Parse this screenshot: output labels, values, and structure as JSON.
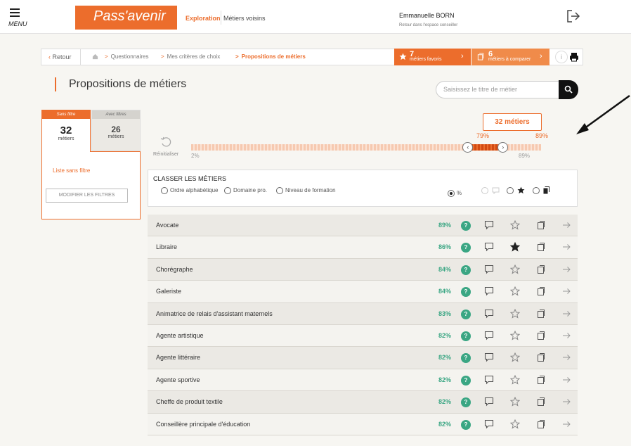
{
  "header": {
    "menu_label": "MENU",
    "logo": "Pass'avenir",
    "nav": [
      "Exploration",
      "Métiers voisins"
    ],
    "user_name": "Emmanuelle BORN",
    "user_sub": "Retour dans l'espace conseiller"
  },
  "breadcrumb": {
    "back": "Retour",
    "items": [
      "Questionnaires",
      "Mes critères de choix",
      "Propositions de métiers"
    ],
    "favorites": {
      "count": "7",
      "label": "métiers favoris"
    },
    "compare": {
      "count": "6",
      "label": "métiers à comparer"
    }
  },
  "page": {
    "title": "Propositions de métiers",
    "search_placeholder": "Saisissez le titre de métier"
  },
  "filters": {
    "tab_no_filter": {
      "label": "Sans filtre",
      "count": "32",
      "unit": "métiers"
    },
    "tab_with_filter": {
      "label": "Avec filtres",
      "count": "26",
      "unit": "métiers"
    },
    "list_label": "Liste sans filtre",
    "modify_button": "MODIFIER LES FILTRES"
  },
  "slider": {
    "count_label": "32 métiers",
    "reset_label": "Réinitialiser",
    "min_label": "2%",
    "range_low_label": "79%",
    "range_high_label": "89%",
    "below_label": "89%",
    "range_low": 0.79,
    "range_high": 0.89
  },
  "sort": {
    "title": "CLASSER LES MÉTIERS",
    "options": [
      "Ordre alphabétique",
      "Domaine pro.",
      "Niveau de formation"
    ],
    "percent_option": "%"
  },
  "jobs": [
    {
      "name": "Avocate",
      "pct": "89%",
      "favorite": false
    },
    {
      "name": "Libraire",
      "pct": "86%",
      "favorite": true
    },
    {
      "name": "Chorégraphe",
      "pct": "84%",
      "favorite": false
    },
    {
      "name": "Galeriste",
      "pct": "84%",
      "favorite": false
    },
    {
      "name": "Animatrice de relais d'assistant maternels",
      "pct": "83%",
      "favorite": false
    },
    {
      "name": "Agente artistique",
      "pct": "82%",
      "favorite": false
    },
    {
      "name": "Agente littéraire",
      "pct": "82%",
      "favorite": false
    },
    {
      "name": "Agente sportive",
      "pct": "82%",
      "favorite": false
    },
    {
      "name": "Cheffe de produit textile",
      "pct": "82%",
      "favorite": false
    },
    {
      "name": "Conseillère principale d'éducation",
      "pct": "82%",
      "favorite": false
    }
  ],
  "colors": {
    "accent": "#ec6d2c",
    "match": "#3aa683"
  }
}
